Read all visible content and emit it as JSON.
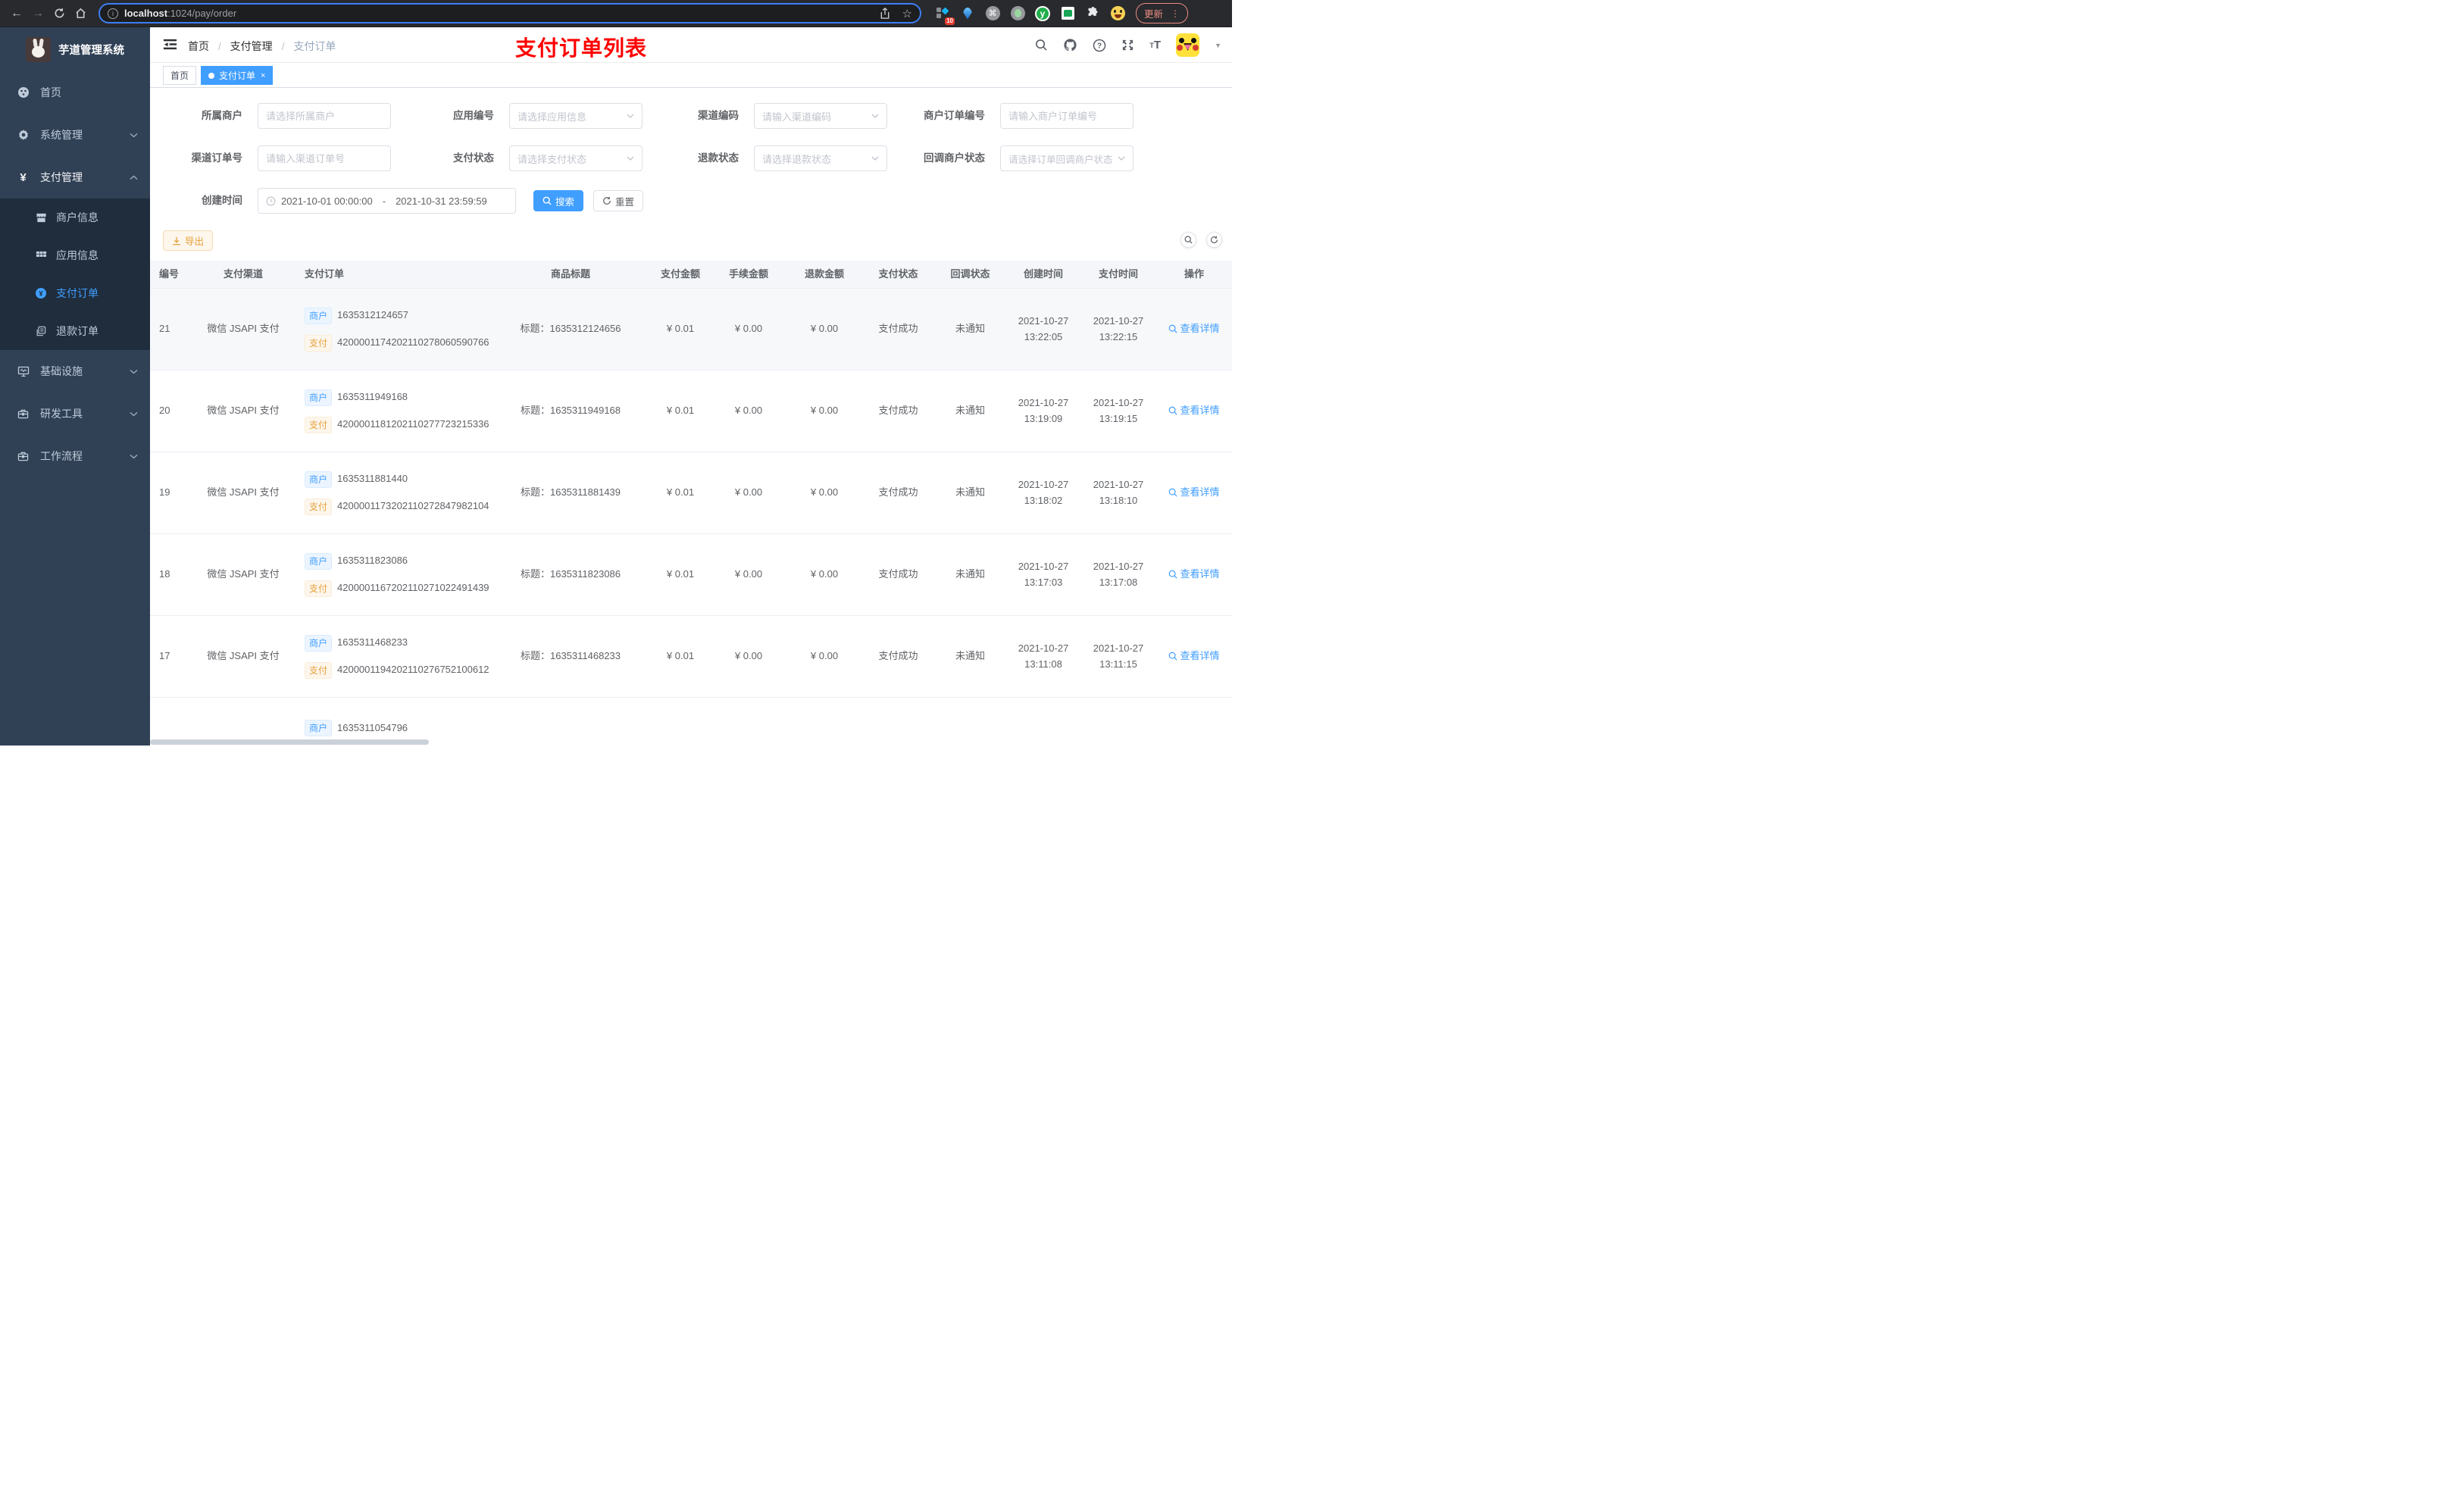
{
  "browser": {
    "url": {
      "host": "localhost",
      "path": ":1024/pay/order"
    },
    "extensions_badge": "10",
    "update_label": "更新"
  },
  "sidebar": {
    "logo_title": "芋道管理系统",
    "menu": [
      {
        "label": "首页"
      },
      {
        "label": "系统管理"
      },
      {
        "label": "支付管理"
      },
      {
        "label": "商户信息"
      },
      {
        "label": "应用信息"
      },
      {
        "label": "支付订单"
      },
      {
        "label": "退款订单"
      },
      {
        "label": "基础设施"
      },
      {
        "label": "研发工具"
      },
      {
        "label": "工作流程"
      }
    ]
  },
  "navbar": {
    "breadcrumb": [
      "首页",
      "支付管理",
      "支付订单"
    ],
    "annotation": "支付订单列表"
  },
  "tabs": [
    {
      "label": "首页"
    },
    {
      "label": "支付订单"
    }
  ],
  "filters": {
    "fields": [
      {
        "label": "所属商户",
        "placeholder": "请选择所属商户"
      },
      {
        "label": "应用编号",
        "placeholder": "请选择应用信息"
      },
      {
        "label": "渠道编码",
        "placeholder": "请输入渠道编码"
      },
      {
        "label": "商户订单编号",
        "placeholder": "请输入商户订单编号"
      },
      {
        "label": "渠道订单号",
        "placeholder": "请输入渠道订单号"
      },
      {
        "label": "支付状态",
        "placeholder": "请选择支付状态"
      },
      {
        "label": "退款状态",
        "placeholder": "请选择退款状态"
      },
      {
        "label": "回调商户状态",
        "placeholder": "请选择订单回调商户状态"
      }
    ],
    "date": {
      "label": "创建时间",
      "start": "2021-10-01 00:00:00",
      "separator": "-",
      "end": "2021-10-31 23:59:59"
    },
    "search_label": "搜索",
    "reset_label": "重置"
  },
  "toolbar": {
    "export_label": "导出"
  },
  "table": {
    "columns": [
      "编号",
      "支付渠道",
      "支付订单",
      "商品标题",
      "支付金额",
      "手续金额",
      "退款金额",
      "支付状态",
      "回调状态",
      "创建时间",
      "支付时间",
      "操作"
    ],
    "merchant_tag": "商户",
    "pay_tag": "支付",
    "action_label": "查看详情",
    "rows": [
      {
        "id": "21",
        "channel": "微信 JSAPI 支付",
        "merchant_no": "1635312124657",
        "pay_no": "4200001174202110278060590766",
        "title": "标题：1635312124656",
        "amount": "¥ 0.01",
        "fee": "¥ 0.00",
        "refund": "¥ 0.00",
        "status": "支付成功",
        "notify": "未通知",
        "create_date": "2021-10-27",
        "create_time": "13:22:05",
        "pay_date": "2021-10-27",
        "pay_time": "13:22:15"
      },
      {
        "id": "20",
        "channel": "微信 JSAPI 支付",
        "merchant_no": "1635311949168",
        "pay_no": "4200001181202110277723215336",
        "title": "标题：1635311949168",
        "amount": "¥ 0.01",
        "fee": "¥ 0.00",
        "refund": "¥ 0.00",
        "status": "支付成功",
        "notify": "未通知",
        "create_date": "2021-10-27",
        "create_time": "13:19:09",
        "pay_date": "2021-10-27",
        "pay_time": "13:19:15"
      },
      {
        "id": "19",
        "channel": "微信 JSAPI 支付",
        "merchant_no": "1635311881440",
        "pay_no": "4200001173202110272847982104",
        "title": "标题：1635311881439",
        "amount": "¥ 0.01",
        "fee": "¥ 0.00",
        "refund": "¥ 0.00",
        "status": "支付成功",
        "notify": "未通知",
        "create_date": "2021-10-27",
        "create_time": "13:18:02",
        "pay_date": "2021-10-27",
        "pay_time": "13:18:10"
      },
      {
        "id": "18",
        "channel": "微信 JSAPI 支付",
        "merchant_no": "1635311823086",
        "pay_no": "4200001167202110271022491439",
        "title": "标题：1635311823086",
        "amount": "¥ 0.01",
        "fee": "¥ 0.00",
        "refund": "¥ 0.00",
        "status": "支付成功",
        "notify": "未通知",
        "create_date": "2021-10-27",
        "create_time": "13:17:03",
        "pay_date": "2021-10-27",
        "pay_time": "13:17:08"
      },
      {
        "id": "17",
        "channel": "微信 JSAPI 支付",
        "merchant_no": "1635311468233",
        "pay_no": "4200001194202110276752100612",
        "title": "标题：1635311468233",
        "amount": "¥ 0.01",
        "fee": "¥ 0.00",
        "refund": "¥ 0.00",
        "status": "支付成功",
        "notify": "未通知",
        "create_date": "2021-10-27",
        "create_time": "13:11:08",
        "pay_date": "2021-10-27",
        "pay_time": "13:11:15"
      }
    ],
    "partial_row": {
      "merchant_no": "1635311054796"
    }
  }
}
